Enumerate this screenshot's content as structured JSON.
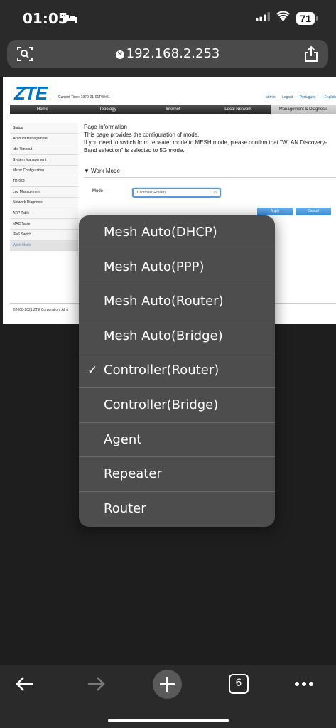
{
  "status_bar": {
    "time": "01:05",
    "battery": "71"
  },
  "url_bar": {
    "url": "192.168.2.253"
  },
  "page": {
    "logo": "ZTE",
    "current_time": "Current Time: 1970-01-01T00:01",
    "top_links": [
      "admin",
      "Logout",
      "Português",
      "| English"
    ],
    "nav": [
      "Home",
      "Topology",
      "Internet",
      "Local Network",
      "Management & Diagnosis"
    ],
    "sidebar": [
      "Status",
      "Account Management",
      "Idle Timeout",
      "System Management",
      "Mirror Configuration",
      "TR-069",
      "Log Management",
      "Network Diagnosis",
      "ARP Table",
      "MAC Table",
      "IPv6 Switch",
      "Work Mode"
    ],
    "info_title": "Page Information",
    "info_line1": "This page provides the configuration of mode.",
    "info_line2": "If you need to switch from repeater mode to MESH mode, please confirm that \"WLAN Discovery-Band selection\" is selected to 5G mode.",
    "work_mode_heading": "Work Mode",
    "mode_label": "Mode",
    "mode_value": "Controller(Router)",
    "apply_label": "Apply",
    "cancel_label": "Cancel",
    "copyright": "©2008-2021 ZTE Corporation. All ri"
  },
  "dropdown": {
    "options": [
      "Mesh Auto(DHCP)",
      "Mesh Auto(PPP)",
      "Mesh Auto(Router)",
      "Mesh Auto(Bridge)",
      "Controller(Router)",
      "Controller(Bridge)",
      "Agent",
      "Repeater",
      "Router"
    ],
    "selected": "Controller(Router)",
    "check": "✓"
  },
  "toolbar": {
    "tab_count": "6"
  }
}
